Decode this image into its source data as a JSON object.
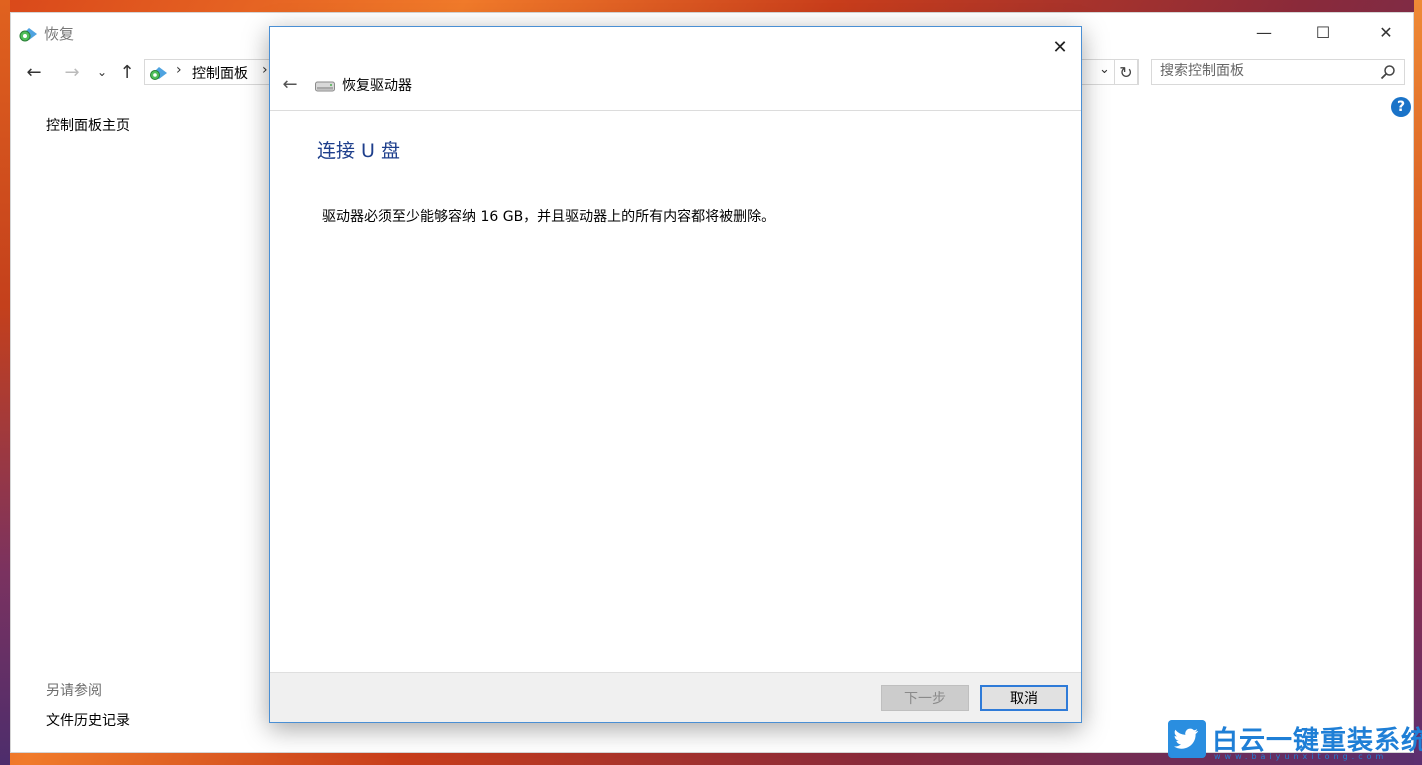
{
  "window": {
    "title": "恢复",
    "minimize": "—",
    "maximize": "☐",
    "close": "✕"
  },
  "nav": {
    "breadcrumb": "控制面板",
    "search_placeholder": "搜索控制面板"
  },
  "sidebar": {
    "home_link": "控制面板主页",
    "see_also_title": "另请参阅",
    "see_also_link": "文件历史记录"
  },
  "dialog": {
    "title": "恢复驱动器",
    "heading": "连接 U 盘",
    "description": "驱动器必须至少能够容纳 16 GB，并且驱动器上的所有内容都将被删除。",
    "next_button": "下一步",
    "cancel_button": "取消",
    "next_enabled": false
  },
  "watermark": {
    "text": "白云一键重装系统",
    "url": "www.baiyunxitong.com"
  },
  "colors": {
    "accent": "#2f7bd8",
    "heading": "#1e3f8c",
    "watermark": "#1f7fd6"
  },
  "icons": [
    "control-panel-icon",
    "back-arrow-icon",
    "forward-arrow-icon",
    "chevron-down-icon",
    "up-arrow-icon",
    "refresh-icon",
    "search-icon",
    "help-icon",
    "close-icon",
    "usb-drive-icon",
    "twitter-bird-icon"
  ]
}
